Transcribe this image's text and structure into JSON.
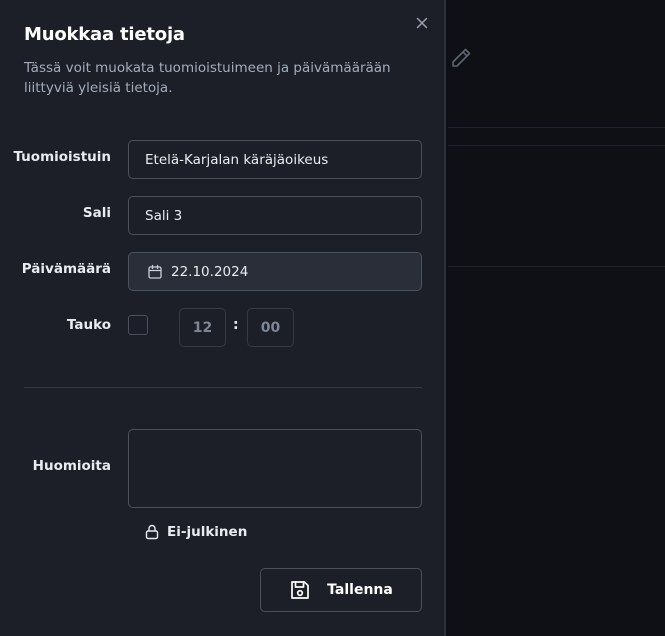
{
  "background": {
    "edit_icon": "pencil-icon"
  },
  "drawer": {
    "title": "Muokkaa tietoja",
    "description": "Tässä voit muokata tuomioistuimeen ja päivämäärään liittyviä yleisiä tietoja.",
    "close_icon": "close-icon"
  },
  "form": {
    "court": {
      "label": "Tuomioistuin",
      "value": "Etelä-Karjalan käräjäoikeus"
    },
    "room": {
      "label": "Sali",
      "value": "Sali 3"
    },
    "date": {
      "label": "Päivämäärä",
      "value": "22.10.2024",
      "icon": "calendar-icon"
    },
    "break": {
      "label": "Tauko",
      "checked": false,
      "hour": "12",
      "separator": ":",
      "minute": "00"
    },
    "notes": {
      "label": "Huomioita",
      "value": ""
    },
    "privacy": {
      "label": "Ei-julkinen",
      "icon": "lock-icon"
    },
    "save": {
      "label": "Tallenna",
      "icon": "save-icon"
    }
  },
  "colors": {
    "panel": "#1c1f27",
    "app_background": "#0e1016",
    "border": "#4a505d",
    "text": "#e8ebf0",
    "muted_text": "#a3acbc"
  }
}
